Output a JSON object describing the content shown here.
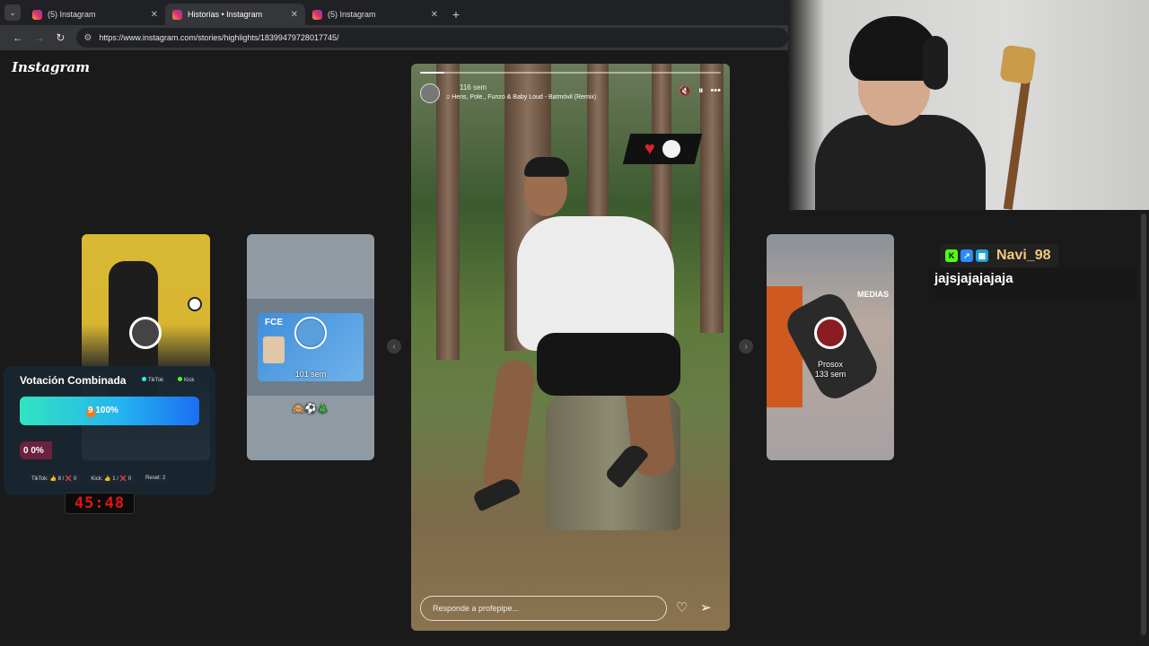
{
  "browser": {
    "tabs": [
      {
        "title": "(5) Instagram",
        "close": "✕"
      },
      {
        "title": "Historias • Instagram",
        "close": "✕"
      },
      {
        "title": "(5) Instagram",
        "close": "✕"
      }
    ],
    "new_tab": "+",
    "url": "https://www.instagram.com/stories/highlights/18399479728017745/"
  },
  "instagram": {
    "logo": "Instagram",
    "cards": {
      "left2_caption": "101 sem",
      "left2_emojis": "🙈⚽🎄",
      "right_caption_name": "Prosox",
      "right_caption_time": "133 sem",
      "right_medias": "MEDIAS"
    },
    "story": {
      "time_ago": "116 sem",
      "music": "Hens, Pole., Funzo & Baby Loud - Batmóvil (Remix)",
      "reply_placeholder": "Responde a profepipe...",
      "progress": 0.08
    }
  },
  "overlay": {
    "chat": {
      "username": "Navi_98",
      "message": "jajsjajajajaja"
    },
    "vote": {
      "title": "Votación Combinada",
      "platform1": "TikTok",
      "platform2": "Kick",
      "bar1_text": "9  100%",
      "bar1_fill": 1.0,
      "bar2_text": "0  0%",
      "footer_tiktok": "TikTok: 👍 8 / ❌ 0",
      "footer_kick": "Kick: 👍 1 / ❌ 0",
      "footer_reset": "Reset: 2",
      "colors": {
        "tiktok": "#25f4ee",
        "kick": "#53fc18"
      }
    },
    "timer": "45:48"
  }
}
